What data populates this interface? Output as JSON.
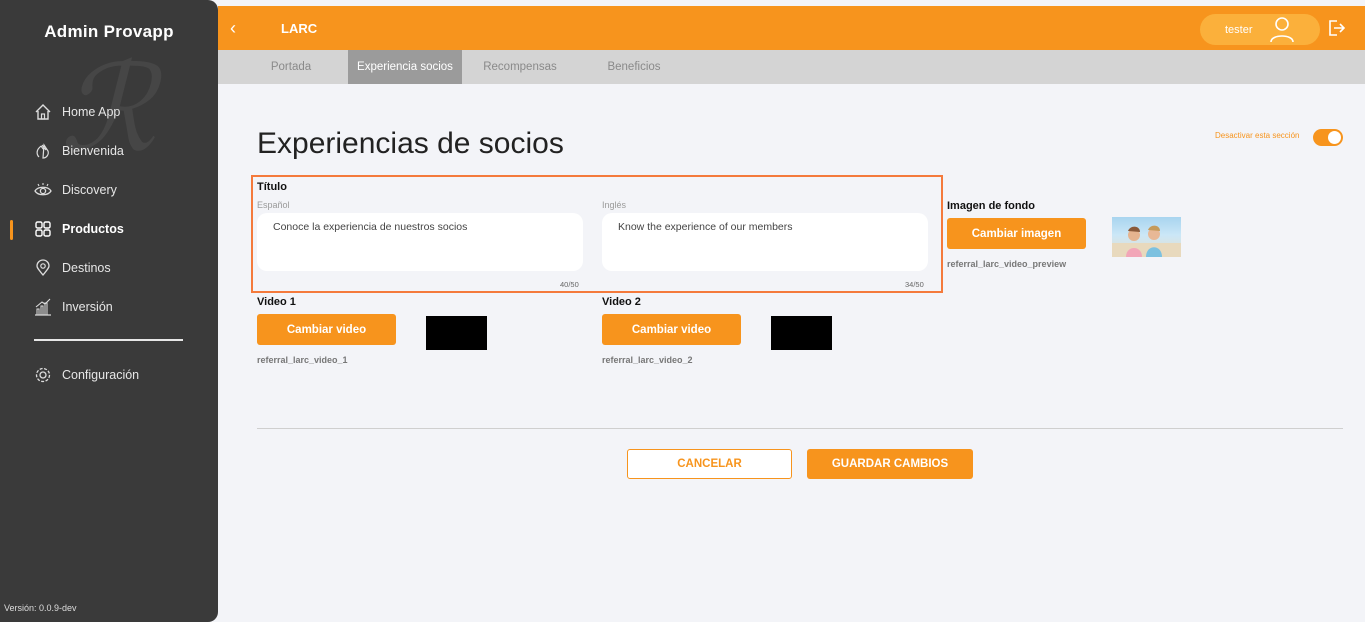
{
  "sidebar": {
    "brand": "Admin Provapp",
    "items": [
      {
        "label": "Home App",
        "icon": "home-icon"
      },
      {
        "label": "Bienvenida",
        "icon": "waving-hand-icon"
      },
      {
        "label": "Discovery",
        "icon": "eye-icon"
      },
      {
        "label": "Productos",
        "icon": "grid-icon",
        "active": true
      },
      {
        "label": "Destinos",
        "icon": "location-pin-icon"
      },
      {
        "label": "Inversión",
        "icon": "bar-chart-icon"
      }
    ],
    "config": {
      "label": "Configuración",
      "icon": "gear-icon"
    },
    "version": "Versión: 0.0.9-dev"
  },
  "header": {
    "title": "LARC",
    "user": "tester"
  },
  "tabs": [
    {
      "label": "Portada",
      "active": false
    },
    {
      "label": "Experiencia socios",
      "active": true
    },
    {
      "label": "Recompensas",
      "active": false
    },
    {
      "label": "Beneficios",
      "active": false
    }
  ],
  "main": {
    "title": "Experiencias de socios",
    "toggle_label": "Desactivar esta sección",
    "toggle_on": true,
    "titulo": {
      "heading": "Título",
      "es_label": "Español",
      "es_value": "Conoce la experiencia de nuestros socios",
      "es_counter": "40/50",
      "en_label": "Inglés",
      "en_value": "Know the experience of our members",
      "en_counter": "34/50"
    },
    "background": {
      "heading": "Imagen de fondo",
      "button": "Cambiar imagen",
      "filename": "referral_larc_video_preview"
    },
    "video1": {
      "heading": "Video 1",
      "button": "Cambiar video",
      "filename": "referral_larc_video_1"
    },
    "video2": {
      "heading": "Video 2",
      "button": "Cambiar video",
      "filename": "referral_larc_video_2"
    },
    "actions": {
      "cancel": "CANCELAR",
      "save": "GUARDAR CAMBIOS"
    }
  },
  "colors": {
    "accent": "#f7941d",
    "sidebar": "#3a3a3a",
    "highlight_border": "#f47a3c"
  }
}
